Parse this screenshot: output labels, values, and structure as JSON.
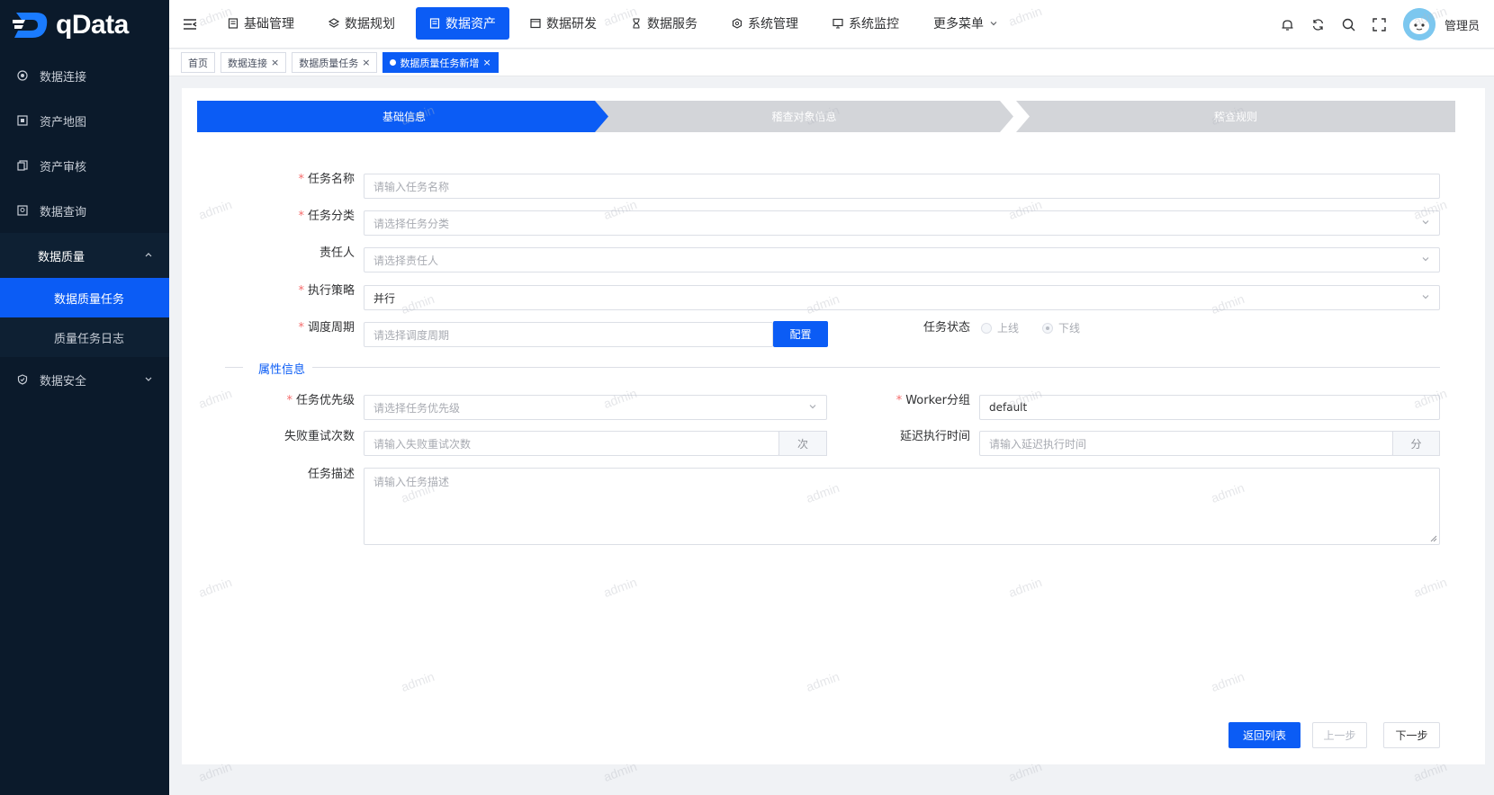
{
  "app": {
    "logo_text": "qData"
  },
  "sidebar": {
    "items": [
      {
        "label": "数据连接",
        "icon": "target-icon"
      },
      {
        "label": "资产地图",
        "icon": "map-icon"
      },
      {
        "label": "资产审核",
        "icon": "copy-icon"
      },
      {
        "label": "数据查询",
        "icon": "query-icon"
      },
      {
        "label": "数据质量",
        "icon": ""
      },
      {
        "label": "数据质量任务",
        "icon": ""
      },
      {
        "label": "质量任务日志",
        "icon": ""
      },
      {
        "label": "数据安全",
        "icon": "shield-icon"
      }
    ]
  },
  "header": {
    "nav": [
      {
        "label": "基础管理"
      },
      {
        "label": "数据规划"
      },
      {
        "label": "数据资产"
      },
      {
        "label": "数据研发"
      },
      {
        "label": "数据服务"
      },
      {
        "label": "系统管理"
      },
      {
        "label": "系统监控"
      },
      {
        "label": "更多菜单"
      }
    ],
    "active_nav": "数据资产",
    "user_name": "管理员"
  },
  "tags": [
    {
      "label": "首页"
    },
    {
      "label": "数据连接"
    },
    {
      "label": "数据质量任务"
    },
    {
      "label": "数据质量任务新增"
    }
  ],
  "steps": [
    {
      "label": "基础信息",
      "state": "active"
    },
    {
      "label": "稽查对象信息",
      "state": "inactive"
    },
    {
      "label": "稽查规则",
      "state": "inactive"
    }
  ],
  "form": {
    "task_name": {
      "label": "任务名称",
      "placeholder": "请输入任务名称"
    },
    "task_category": {
      "label": "任务分类",
      "placeholder": "请选择任务分类"
    },
    "owner": {
      "label": "责任人",
      "placeholder": "请选择责任人"
    },
    "strategy": {
      "label": "执行策略",
      "value": "并行"
    },
    "schedule": {
      "label": "调度周期",
      "placeholder": "请选择调度周期",
      "button": "配置"
    },
    "task_status": {
      "label": "任务状态",
      "options": [
        "上线",
        "下线"
      ],
      "selected": "下线"
    },
    "section_title": "属性信息",
    "priority": {
      "label": "任务优先级",
      "placeholder": "请选择任务优先级"
    },
    "worker_group": {
      "label": "Worker分组",
      "value": "default"
    },
    "retry": {
      "label": "失败重试次数",
      "placeholder": "请输入失败重试次数",
      "suffix": "次"
    },
    "delay": {
      "label": "延迟执行时间",
      "placeholder": "请输入延迟执行时间",
      "suffix": "分"
    },
    "description": {
      "label": "任务描述",
      "placeholder": "请输入任务描述"
    }
  },
  "footer": {
    "back": "返回列表",
    "prev": "上一步",
    "next": "下一步"
  },
  "watermark": "admin",
  "colors": {
    "primary": "#0b5cf5",
    "sidebar_bg": "#0b1a2b",
    "required": "#f56c6c"
  }
}
